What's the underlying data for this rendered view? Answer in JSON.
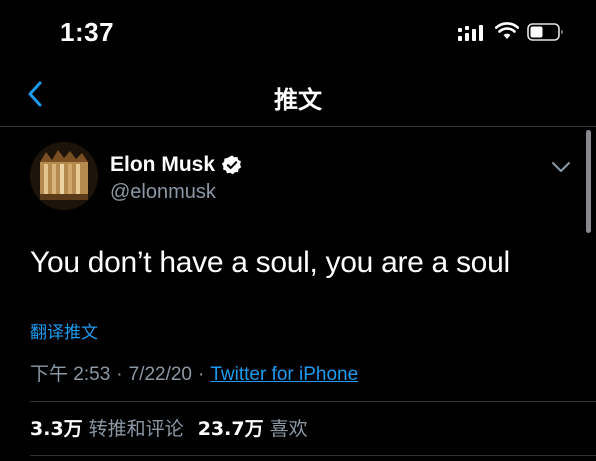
{
  "status_bar": {
    "time": "1:37",
    "icons": [
      "signal-icon",
      "wifi-icon",
      "battery-icon"
    ]
  },
  "nav": {
    "back_icon": "chevron-left-icon",
    "title": "推文"
  },
  "tweet": {
    "author_name": "Elon Musk",
    "author_handle": "@elonmusk",
    "verified": true,
    "text": "You don’t have a soul, you are a soul",
    "translate_label": "翻译推文",
    "time": "下午 2:53",
    "date": "7/22/20",
    "separator": "·",
    "source": "Twitter for iPhone",
    "stats": {
      "retweets_count": "3.3万",
      "retweets_label": "转推和评论",
      "likes_count": "23.7万",
      "likes_label": "喜欢"
    }
  },
  "colors": {
    "background": "#000000",
    "accent": "#1d9bf0",
    "secondary_text": "#8b98a5",
    "divider": "#2f3336"
  }
}
